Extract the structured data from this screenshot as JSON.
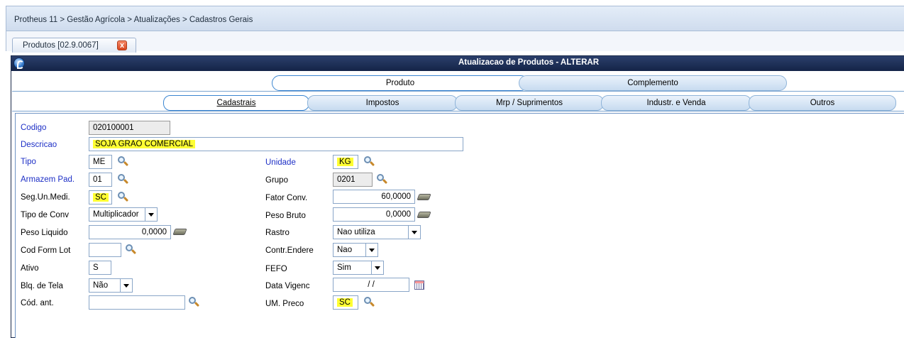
{
  "breadcrumb": "Protheus 11 > Gestão Agrícola > Atualizações > Cadastros Gerais",
  "doc_tab": {
    "label": "Produtos [02.9.0067]",
    "close": "x"
  },
  "window": {
    "title": "Atualizacao de Produtos - ALTERAR"
  },
  "folders": {
    "produto": "Produto",
    "complemento": "Complemento"
  },
  "subtabs": {
    "cadastrais": "Cadastrais",
    "impostos": "Impostos",
    "mrp": "Mrp / Suprimentos",
    "industr": "Industr. e Venda",
    "outros": "Outros"
  },
  "form": {
    "codigo": {
      "label": "Codigo",
      "value": "020100001"
    },
    "descricao": {
      "label": "Descricao",
      "value": "SOJA GRAO COMERCIAL"
    },
    "tipo": {
      "label": "Tipo",
      "value": "ME"
    },
    "armazem": {
      "label": "Armazem Pad.",
      "value": "01"
    },
    "segun": {
      "label": "Seg.Un.Medi.",
      "value": "SC"
    },
    "tipoconv": {
      "label": "Tipo de Conv",
      "value": "Multiplicador"
    },
    "pesoliq": {
      "label": "Peso Liquido",
      "value": "0,0000"
    },
    "codform": {
      "label": "Cod Form Lot",
      "value": ""
    },
    "ativo": {
      "label": "Ativo",
      "value": "S"
    },
    "blqtela": {
      "label": "Blq. de Tela",
      "value": "Não"
    },
    "codant": {
      "label": "Cód. ant.",
      "value": ""
    },
    "unidade": {
      "label": "Unidade",
      "value": "KG"
    },
    "grupo": {
      "label": "Grupo",
      "value": "0201"
    },
    "fatorconv": {
      "label": "Fator Conv.",
      "value": "60,0000"
    },
    "pesobruto": {
      "label": "Peso Bruto",
      "value": "0,0000"
    },
    "rastro": {
      "label": "Rastro",
      "value": "Nao utiliza"
    },
    "contrendere": {
      "label": "Contr.Endere",
      "value": "Nao"
    },
    "fefo": {
      "label": "FEFO",
      "value": "Sim"
    },
    "datavigenc": {
      "label": "Data Vigenc",
      "value": "/ /"
    },
    "umpreco": {
      "label": "UM. Preco",
      "value": "SC"
    }
  }
}
